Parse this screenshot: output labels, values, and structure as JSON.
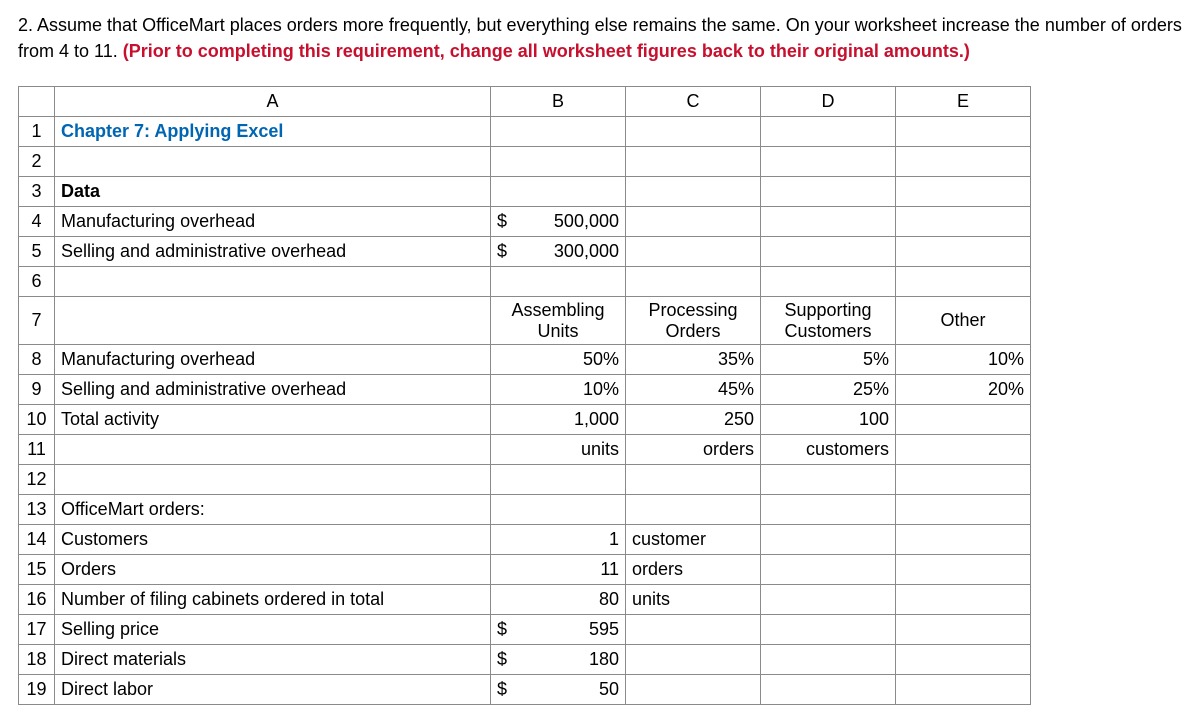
{
  "question": {
    "prefix": "2. Assume that OfficeMart places orders more frequently, but everything else remains the same. On your worksheet increase the number of orders from 4 to 11. ",
    "red": "(Prior to completing this requirement, change all worksheet figures back to their original amounts.)"
  },
  "columns": {
    "A": "A",
    "B": "B",
    "C": "C",
    "D": "D",
    "E": "E"
  },
  "rows": {
    "r1": {
      "num": "1",
      "A": "Chapter 7: Applying Excel"
    },
    "r2": {
      "num": "2"
    },
    "r3": {
      "num": "3",
      "A": "Data"
    },
    "r4": {
      "num": "4",
      "A": "Manufacturing overhead",
      "Bcur": "$",
      "Bval": "500,000"
    },
    "r5": {
      "num": "5",
      "A": "Selling and administrative overhead",
      "Bcur": "$",
      "Bval": "300,000"
    },
    "r6": {
      "num": "6"
    },
    "r7": {
      "num": "7",
      "B": "Assembling Units",
      "C": "Processing Orders",
      "D": "Supporting Customers",
      "E": "Other"
    },
    "r8": {
      "num": "8",
      "A": "Manufacturing overhead",
      "B": "50%",
      "C": "35%",
      "D": "5%",
      "E": "10%"
    },
    "r9": {
      "num": "9",
      "A": "Selling and administrative overhead",
      "B": "10%",
      "C": "45%",
      "D": "25%",
      "E": "20%"
    },
    "r10": {
      "num": "10",
      "A": "Total activity",
      "B": "1,000",
      "C": "250",
      "D": "100"
    },
    "r11": {
      "num": "11",
      "B": "units",
      "C": "orders",
      "D": "customers"
    },
    "r12": {
      "num": "12"
    },
    "r13": {
      "num": "13",
      "A": "OfficeMart orders:"
    },
    "r14": {
      "num": "14",
      "A": "Customers",
      "B": "1",
      "C": "customer"
    },
    "r15": {
      "num": "15",
      "A": "Orders",
      "B": "11",
      "C": "orders"
    },
    "r16": {
      "num": "16",
      "A": "Number of filing cabinets ordered in total",
      "B": "80",
      "C": "units"
    },
    "r17": {
      "num": "17",
      "A": "Selling price",
      "Bcur": "$",
      "Bval": "595"
    },
    "r18": {
      "num": "18",
      "A": "Direct materials",
      "Bcur": "$",
      "Bval": "180"
    },
    "r19": {
      "num": "19",
      "A": "Direct labor",
      "Bcur": "$",
      "Bval": "50"
    }
  }
}
